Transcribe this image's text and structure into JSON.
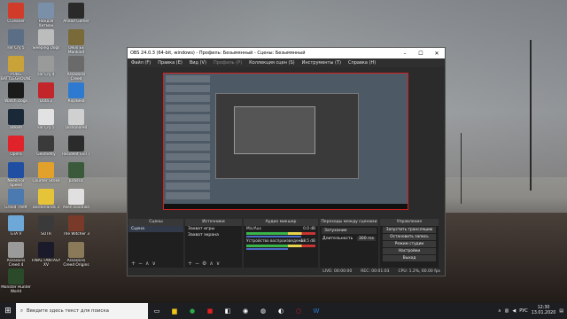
{
  "desktop": {
    "icons": [
      {
        "label": "CCleaner",
        "color": "#d13b2a"
      },
      {
        "label": "Ниндзя Хитман",
        "color": "#7a8fa8"
      },
      {
        "label": "Ahead Gamer",
        "color": "#2a2a2a"
      },
      {
        "label": "Far Cry 5",
        "color": "#5b6e86"
      },
      {
        "label": "Sleeping Dogs",
        "color": "#bcbcbc"
      },
      {
        "label": "Deus Ex Mankind",
        "color": "#7a6a3a"
      },
      {
        "label": "PUBG BATTLEGROUNDS",
        "color": "#caa23a"
      },
      {
        "label": "Far Cry 4",
        "color": "#9a9a9a"
      },
      {
        "label": "Assassins Creed",
        "color": "#6a6a6a"
      },
      {
        "label": "Watch Dogs",
        "color": "#1b1b1b"
      },
      {
        "label": "Dota 2",
        "color": "#c2262a"
      },
      {
        "label": "Корзина",
        "color": "#2e7ad1"
      },
      {
        "label": "Steam",
        "color": "#1b2838"
      },
      {
        "label": "Far Cry 5",
        "color": "#e2e2e2"
      },
      {
        "label": "Dishonored",
        "color": "#d0d0d0"
      },
      {
        "label": "Opera",
        "color": "#e0222b"
      },
      {
        "label": "Geometry",
        "color": "#3a3a3a"
      },
      {
        "label": "Resident Evil 7",
        "color": "#2b2b2b"
      },
      {
        "label": "Need For Speed",
        "color": "#1f4ea3"
      },
      {
        "label": "Counter Strike",
        "color": "#e1a12b"
      },
      {
        "label": "Jurassic",
        "color": "#3b5a3b"
      },
      {
        "label": "Grand Theft",
        "color": "#4a7ab0"
      },
      {
        "label": "Borderlands 3",
        "color": "#e5c43a"
      },
      {
        "label": "Alien Isolation",
        "color": "#e0e0e0"
      },
      {
        "label": "GTA V",
        "color": "#6ea8d8"
      },
      {
        "label": "SOTR",
        "color": "#3a3a3a"
      },
      {
        "label": "The Witcher 3",
        "color": "#7a3a2a"
      },
      {
        "label": "Assassins Creed 4",
        "color": "#9a9a9a"
      },
      {
        "label": "FINAL FANTASY XV",
        "color": "#1a1a2a"
      },
      {
        "label": "Assassins Creed Origins",
        "color": "#8a7a5a"
      },
      {
        "label": "Monster Hunter World",
        "color": "#2a4a2a"
      }
    ]
  },
  "obs": {
    "title": "OBS 24.0.3 (64-bit, windows) - Профиль: Безымянный - Сцены: Безымянный",
    "menu": [
      "Файл (F)",
      "Правка (E)",
      "Вид (V)",
      "Профиль (P)",
      "Коллекция сцен (S)",
      "Инструменты (T)",
      "Справка (H)"
    ],
    "docks": {
      "scenes": {
        "title": "Сцены",
        "items": [
          "Сцена"
        ]
      },
      "sources": {
        "title": "Источники",
        "items": [
          "Захват игры",
          "Захват экрана"
        ]
      },
      "mixer": {
        "title": "Аудио микшер",
        "rows": [
          {
            "name": "Mic/Aux",
            "db": "0.0 dB"
          },
          {
            "name": "Устройство воспроизведения",
            "db": "-13.5 dB"
          }
        ]
      },
      "transitions": {
        "title": "Переходы между сценами",
        "type": "Затухание",
        "duration_label": "Длительность",
        "duration": "300 ms"
      },
      "controls": {
        "title": "Управление",
        "buttons": [
          "Запустить трансляцию",
          "Остановить запись",
          "Режим студии",
          "Настройки",
          "Выход"
        ]
      }
    },
    "status": {
      "live": "LIVE: 00:00:00",
      "rec": "REC: 00:01:03",
      "cpu": "CPU: 1.2%, 60.00 fps"
    }
  },
  "taskbar": {
    "search_placeholder": "Введите здесь текст для поиска",
    "lang": "РУС",
    "time": "12:30",
    "date": "13.01.2020"
  }
}
